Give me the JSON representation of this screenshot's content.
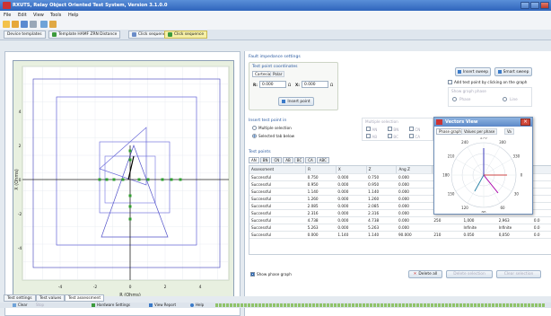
{
  "window": {
    "title": "RXUTS, Relay Object Oriented Test System, Version 3.1.0.0"
  },
  "menu": [
    "File",
    "Edit",
    "View",
    "Tools",
    "Help"
  ],
  "tabs": [
    "Device templates",
    "Template HAMF ZRN Distance",
    "Click sequence",
    "Click sequence"
  ],
  "graph": {
    "x_label": "R (Ohms)",
    "y_label": "X (Ohms)",
    "x_ticks": [
      "-4",
      "-2",
      "0",
      "2",
      "4"
    ],
    "y_ticks": [
      "4",
      "2",
      "0",
      "-2",
      "-4"
    ]
  },
  "fault": {
    "section_title": "Fault impedance settings",
    "coords_title": "Test point coordinates",
    "coord_tabs": [
      "Cartesian",
      "Polar"
    ],
    "r_label": "R:",
    "r_value": "0.000",
    "x_label": "X:",
    "x_value": "0.000",
    "unit": "Ω",
    "insert_point": "Insert point"
  },
  "sweep": {
    "insert_sweep": "Insert sweep",
    "smart_sweep": "Smart sweep",
    "add_by_click": "Add test point by clicking on the graph",
    "group_label": "Show graph phase",
    "phase": "Phase",
    "line": "Line"
  },
  "insert_in": {
    "title": "Insert test point in",
    "multiple": "Multiple selection",
    "selected_tab": "Selected tab below",
    "phase_title": "Multiple selection",
    "phases": [
      "AN",
      "BN",
      "CN",
      "AB",
      "BC",
      "CA"
    ]
  },
  "test_points": {
    "title": "Test points",
    "tabs": [
      "AN",
      "BN",
      "CN",
      "AB",
      "BC",
      "CA",
      "ABC"
    ],
    "columns": [
      "Assessment",
      "R",
      "X",
      "Z",
      "Ang Z",
      "Zone",
      "",
      "",
      ""
    ],
    "rows": [
      [
        "Successful",
        "0.750",
        "0.000",
        "0.750",
        "0.000",
        "210",
        "",
        "",
        ""
      ],
      [
        "Successful",
        "0.950",
        "0.000",
        "0.950",
        "0.000",
        "225",
        "",
        "",
        ""
      ],
      [
        "Successful",
        "1.140",
        "0.000",
        "1.140",
        "0.000",
        "240",
        "",
        "",
        ""
      ],
      [
        "Successful",
        "1.260",
        "0.000",
        "1.260",
        "0.000",
        "240",
        "",
        "",
        ""
      ],
      [
        "Successful",
        "2.085",
        "0.000",
        "2.085",
        "0.000",
        "240",
        "",
        "",
        ""
      ],
      [
        "Successful",
        "2.316",
        "0.000",
        "2.316",
        "0.000",
        "240",
        "",
        "",
        ""
      ],
      [
        "Successful",
        "4.738",
        "0.000",
        "4.738",
        "0.000",
        "250",
        "1,000",
        "2,963",
        "0.0"
      ],
      [
        "Successful",
        "5.263",
        "0.000",
        "5.263",
        "0.000",
        "",
        "Infinite",
        "Infinite",
        "0.0"
      ],
      [
        "Successful",
        "0.000",
        "1.140",
        "1.140",
        "90.000",
        "210",
        "0.050",
        "0,050",
        "0.0"
      ]
    ],
    "show_phase": "Show phase graph",
    "delete_all": "Delete all",
    "delete_selection": "Delete selection",
    "clear_selection": "Clear selection"
  },
  "vector_view": {
    "title": "Vectors View",
    "tabs": [
      "Phase graph",
      "Values per phase",
      "Va"
    ],
    "angles": [
      "270",
      "300",
      "330",
      "0",
      "30",
      "60",
      "90",
      "120",
      "150",
      "180",
      "210",
      "240"
    ]
  },
  "bottom_tabs": [
    "Test settings",
    "Test values",
    "Test assessment"
  ],
  "status": {
    "clear": "Clear",
    "stop": "Stop",
    "hardware": "Hardware Settings",
    "report": "View Report",
    "help": "Help"
  }
}
